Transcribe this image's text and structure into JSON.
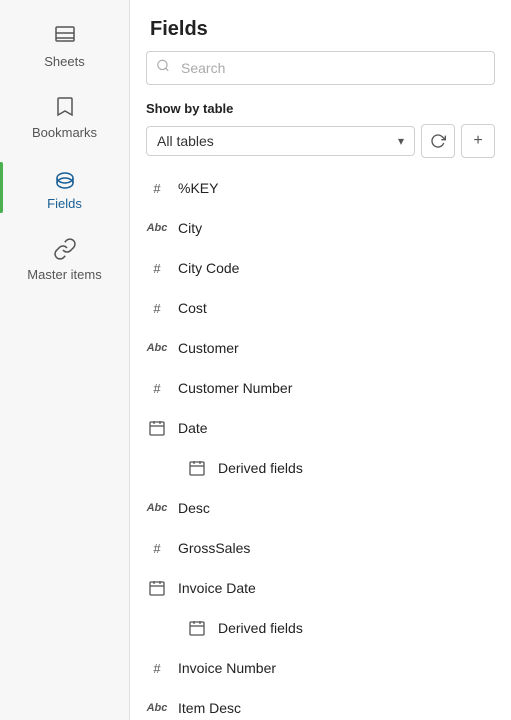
{
  "sidebar": {
    "items": [
      {
        "id": "sheets",
        "label": "Sheets",
        "icon": "sheets-icon",
        "active": false
      },
      {
        "id": "bookmarks",
        "label": "Bookmarks",
        "icon": "bookmarks-icon",
        "active": false
      },
      {
        "id": "fields",
        "label": "Fields",
        "icon": "fields-icon",
        "active": true
      },
      {
        "id": "master-items",
        "label": "Master items",
        "icon": "master-items-icon",
        "active": false
      }
    ]
  },
  "header": {
    "title": "Fields"
  },
  "search": {
    "placeholder": "Search"
  },
  "table_filter": {
    "label": "Show by table",
    "selected": "All tables",
    "refresh_label": "↺",
    "add_label": "+"
  },
  "fields": [
    {
      "id": "key",
      "name": "%KEY",
      "type": "hash"
    },
    {
      "id": "city",
      "name": "City",
      "type": "abc"
    },
    {
      "id": "city-code",
      "name": "City Code",
      "type": "hash"
    },
    {
      "id": "cost",
      "name": "Cost",
      "type": "hash"
    },
    {
      "id": "customer",
      "name": "Customer",
      "type": "abc"
    },
    {
      "id": "customer-number",
      "name": "Customer Number",
      "type": "hash"
    },
    {
      "id": "date",
      "name": "Date",
      "type": "cal",
      "sub": [
        {
          "id": "date-derived",
          "name": "Derived fields",
          "type": "cal-sub"
        }
      ]
    },
    {
      "id": "desc",
      "name": "Desc",
      "type": "abc"
    },
    {
      "id": "gross-sales",
      "name": "GrossSales",
      "type": "hash"
    },
    {
      "id": "invoice-date",
      "name": "Invoice Date",
      "type": "cal",
      "sub": [
        {
          "id": "invoice-date-derived",
          "name": "Derived fields",
          "type": "cal-sub"
        }
      ]
    },
    {
      "id": "invoice-number",
      "name": "Invoice Number",
      "type": "hash"
    },
    {
      "id": "item-desc",
      "name": "Item Desc",
      "type": "abc"
    }
  ]
}
